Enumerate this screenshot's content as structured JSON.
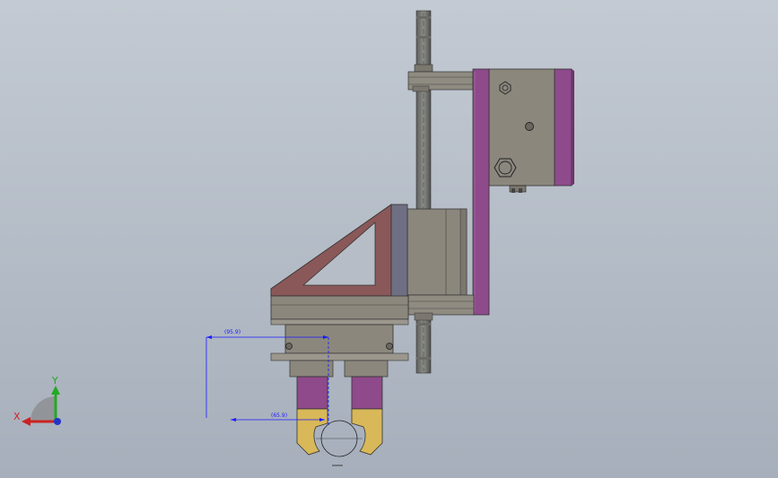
{
  "dimensions": {
    "top_value": "(95.9)",
    "bottom_value": "(65.9)"
  },
  "triad": {
    "x_label": "X",
    "y_label": "Y"
  },
  "colors": {
    "background_top": "#c3cad3",
    "background_bottom": "#a6afbb",
    "metal_grey": "#8b877d",
    "purple_plate": "#8e4a8a",
    "red_bracket": "#8a5858",
    "gold_finger": "#d8b858",
    "dimension_blue": "#1a1aff"
  }
}
